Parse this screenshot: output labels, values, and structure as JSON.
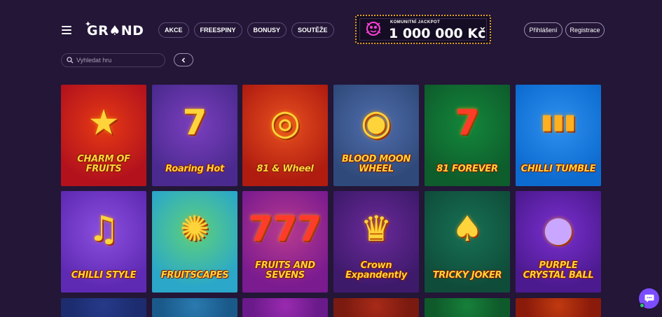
{
  "header": {
    "logo_text": "GR♠ND",
    "nav": [
      "AKCE",
      "FREESPINY",
      "BONUSY",
      "SOUTĚŽE"
    ],
    "jackpot": {
      "label": "KOMUNITNÍ JACKPOT",
      "value": "1 000 000 Kč"
    },
    "login_label": "Přihlášení",
    "register_label": "Registrace"
  },
  "search": {
    "placeholder": "Vyhledat hru"
  },
  "games": [
    {
      "title": "CHARM OF FRUITS",
      "bg": "#b3121d",
      "bg2": "#e63a14",
      "icon": "star-fruit-icon"
    },
    {
      "title": "Roaring Hot",
      "bg": "#4b2a8f",
      "bg2": "#7b3fbf",
      "icon": "flaming-seven-icon"
    },
    {
      "title": "81 & Wheel",
      "bg": "#b01d10",
      "bg2": "#e8501f",
      "icon": "wheel-icon"
    },
    {
      "title": "BLOOD MOON WHEEL",
      "bg": "#2f4a7a",
      "bg2": "#516eae",
      "icon": "eye-wheel-icon"
    },
    {
      "title": "81 FOREVER",
      "bg": "#0e5d2c",
      "bg2": "#13873b",
      "icon": "red-seven-icon"
    },
    {
      "title": "CHILLI TUMBLE",
      "bg": "#0d6bd0",
      "bg2": "#2f91ef",
      "icon": "tequila-shots-icon"
    },
    {
      "title": "CHILLI STYLE",
      "bg": "#5f2ab3",
      "bg2": "#8b4fe0",
      "icon": "guitar-icon"
    },
    {
      "title": "FRUITSCAPES",
      "bg": "#2aa7c9",
      "bg2": "#5fd17a",
      "icon": "fortune-wheel-icon"
    },
    {
      "title": "FRUITS AND SEVENS",
      "bg": "#7a1b8f",
      "bg2": "#b83a8f",
      "icon": "triple-seven-icon"
    },
    {
      "title": "Crown Expandently",
      "bg": "#3e1a6b",
      "bg2": "#6a2a9a",
      "icon": "crown-icon"
    },
    {
      "title": "TRICKY JOKER",
      "bg": "#0f4d3a",
      "bg2": "#177055",
      "icon": "joker-icon"
    },
    {
      "title": "PURPLE CRYSTAL BALL",
      "bg": "#4c1a8f",
      "bg2": "#7a2fd0",
      "icon": "crystal-ball-icon"
    },
    {
      "title": "",
      "bg": "#1c2c6e",
      "bg2": "#263a8a",
      "icon": ""
    },
    {
      "title": "",
      "bg": "#1a5a8a",
      "bg2": "#2a7ab0",
      "icon": ""
    },
    {
      "title": "",
      "bg": "#6a1a8a",
      "bg2": "#9a2ab0",
      "icon": ""
    },
    {
      "title": "",
      "bg": "#7a1a10",
      "bg2": "#a82a18",
      "icon": ""
    },
    {
      "title": "",
      "bg": "#0f5a2a",
      "bg2": "#17803a",
      "icon": ""
    },
    {
      "title": "",
      "bg": "#8a1a0a",
      "bg2": "#c03a10",
      "icon": ""
    }
  ]
}
